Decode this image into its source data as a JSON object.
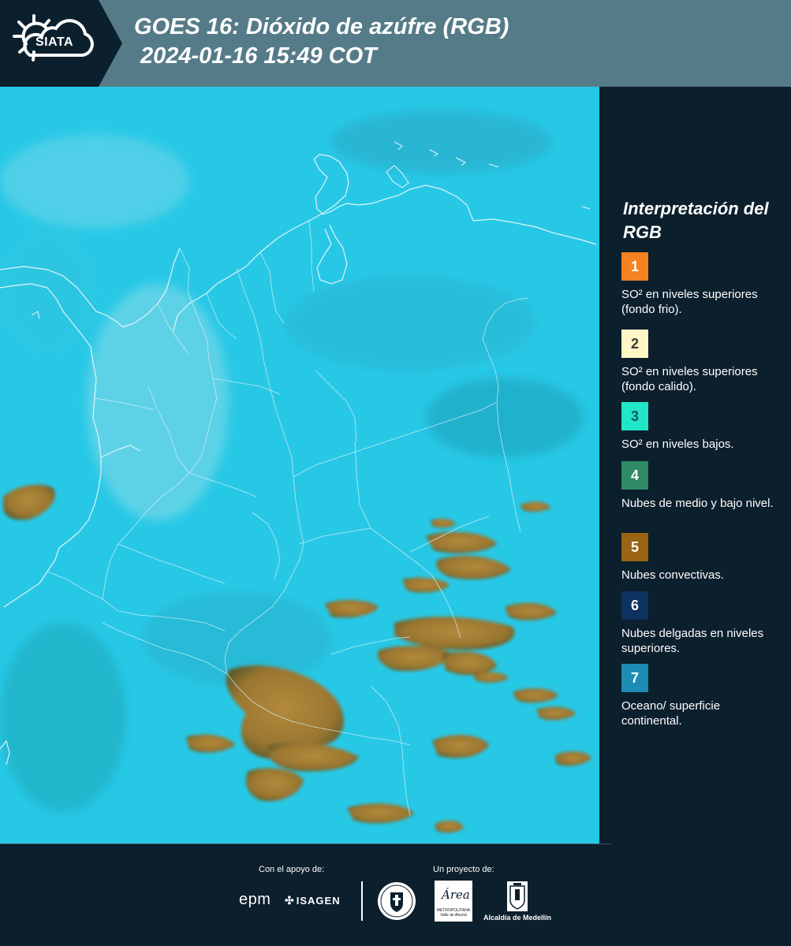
{
  "header": {
    "logo_text": "SIATA",
    "title_line1": "GOES 16: Dióxido de azúfre (RGB)",
    "title_line2": "2024-01-16 15:49 COT"
  },
  "map": {
    "description_colors": {
      "background": "#27c8e6",
      "convective": "#9a7a32",
      "borders": "#e8f4f8"
    }
  },
  "legend": {
    "title": "Interpretación del RGB",
    "items": [
      {
        "number": "1",
        "color": "#f58220",
        "label": "SO² en niveles superiores (fondo frio)."
      },
      {
        "number": "2",
        "color": "#fff8c6",
        "label": "SO² en niveles superiores (fondo calido)."
      },
      {
        "number": "3",
        "color": "#22e6c8",
        "label": "SO² en niveles bajos."
      },
      {
        "number": "4",
        "color": "#2f8a68",
        "label": "Nubes de medio y bajo nivel."
      },
      {
        "number": "5",
        "color": "#9a6414",
        "label": "Nubes convectivas."
      },
      {
        "number": "6",
        "color": "#0e3260",
        "label": "Nubes delgadas en niveles superiores."
      },
      {
        "number": "7",
        "color": "#1c8cb6",
        "label": "Oceano/ superficie continental."
      }
    ]
  },
  "footer": {
    "support_label": "Con el apoyo de:",
    "project_label": "Un proyecto de:",
    "epm_label": "epm",
    "isagen_label": "ISAGEN",
    "area_word": "Área",
    "area_subtitle": "METROPOLITANA Valle de Aburrá",
    "alcaldia_label": "Alcaldía de Medellín"
  }
}
